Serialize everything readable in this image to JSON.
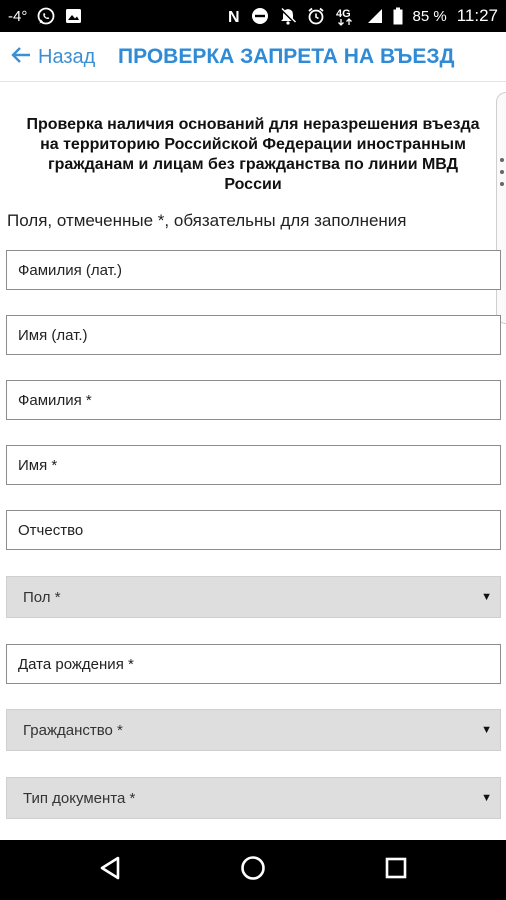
{
  "status_bar": {
    "temperature": "-4°",
    "network": "4G",
    "battery": "85 %",
    "time": "11:27",
    "left_icons": [
      "whatsapp-icon",
      "image-icon"
    ],
    "right_icons": [
      "nfc-icon",
      "do-not-disturb-icon",
      "notifications-off-icon",
      "alarm-icon",
      "signal-icon",
      "battery-icon"
    ]
  },
  "header": {
    "back_label": "Назад",
    "title": "ПРОВЕРКА ЗАПРЕТА НА ВЪЕЗД"
  },
  "form": {
    "heading": "Проверка наличия оснований для неразрешения въезда на территорию Российской Федерации иностранным гражданам и лицам без гражданства по линии МВД России",
    "required_note": "Поля, отмеченные *, обязательны для заполнения",
    "fields": [
      {
        "placeholder": "Фамилия (лат.)",
        "value": ""
      },
      {
        "placeholder": "Имя (лат.)",
        "value": ""
      },
      {
        "placeholder": "Фамилия *",
        "value": ""
      },
      {
        "placeholder": "Имя *",
        "value": ""
      },
      {
        "placeholder": "Отчество",
        "value": ""
      }
    ],
    "gender_select": {
      "label": "Пол *"
    },
    "birth_date_field": {
      "placeholder": "Дата рождения *",
      "value": ""
    },
    "citizenship_select": {
      "label": "Гражданство *"
    },
    "document_type_select": {
      "label": "Тип документа *"
    }
  },
  "nav_bar": {
    "buttons": [
      "back-triangle-icon",
      "home-circle-icon",
      "recents-square-icon"
    ]
  },
  "colors": {
    "accent": "#2f8bd6",
    "select_background": "#dedede",
    "field_border": "#8d8d8d"
  }
}
